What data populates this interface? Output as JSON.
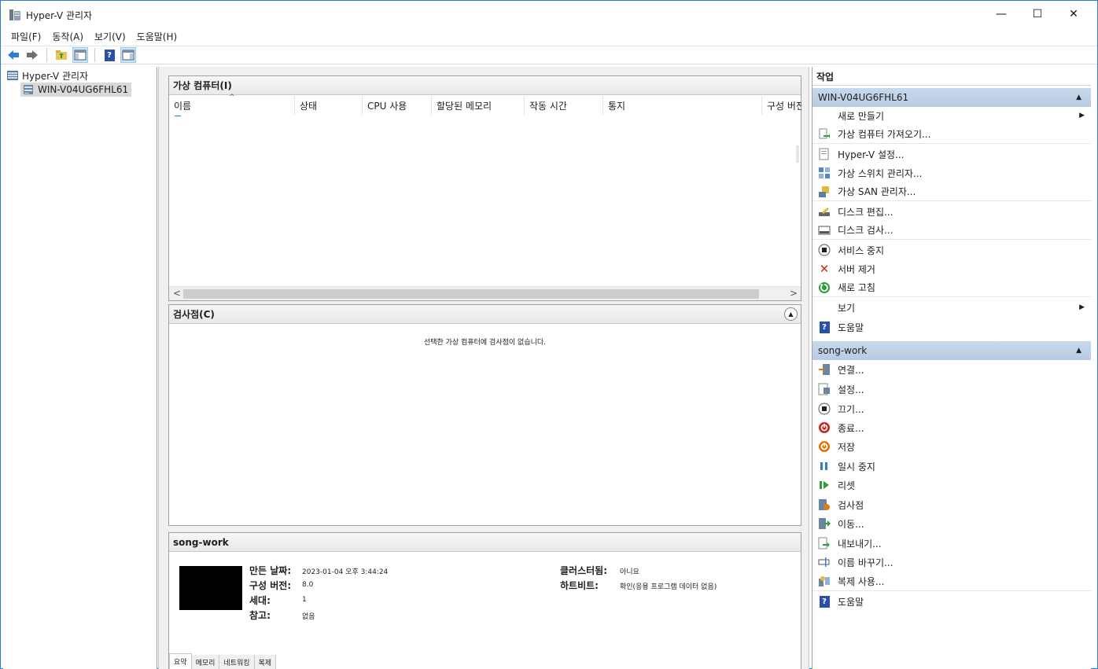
{
  "window": {
    "title": "Hyper-V 관리자",
    "controls": {
      "minimize": "—",
      "maximize": "☐",
      "close": "✕"
    }
  },
  "menu": [
    "파일(F)",
    "동작(A)",
    "보기(V)",
    "도움말(H)"
  ],
  "toolbar": {
    "icons": [
      "back-arrow-icon",
      "forward-arrow-icon",
      "up-folder-icon",
      "show-hide-tree-icon",
      "help-icon",
      "show-hide-action-pane-icon"
    ]
  },
  "tree": {
    "root": "Hyper-V 관리자",
    "child": "WIN-V04UG6FHL61"
  },
  "vm_panel": {
    "title": "가상 컴퓨터(I)",
    "columns": [
      "이름",
      "상태",
      "CPU 사용",
      "할당된 메모리",
      "작동 시간",
      "통지",
      "구성 버전"
    ],
    "sort_glyph": "^",
    "scroll_left": "<",
    "scroll_right": ">"
  },
  "checkpoint_panel": {
    "title": "검사점(C)",
    "empty_message": "선택한 가상 컴퓨터에 검사점이 없습니다.",
    "collapse_glyph": "▲"
  },
  "summary_panel": {
    "title": "song-work",
    "created_label": "만든 날짜:",
    "created_value": "2023-01-04 오후 3:44:24",
    "config_label": "구성 버전:",
    "config_value": "8.0",
    "generation_label": "세대:",
    "generation_value": "1",
    "notes_label": "참고:",
    "notes_value": "없음",
    "clustered_label": "클러스터됨:",
    "clustered_value": "아니요",
    "heartbeat_label": "하트비트:",
    "heartbeat_value": "확인(응용 프로그램 데이터 없음)",
    "tabs": [
      "요약",
      "메모리",
      "네트워킹",
      "복제"
    ]
  },
  "actions": {
    "title": "작업",
    "server_section": {
      "title": "WIN-V04UG6FHL61",
      "items": [
        {
          "label": "새로 만들기",
          "icon": "none",
          "submenu": "▶"
        },
        {
          "label": "가상 컴퓨터 가져오기...",
          "icon": "import-vm-icon"
        },
        {
          "label": "Hyper-V 설정...",
          "icon": "settings-page-icon"
        },
        {
          "label": "가상 스위치 관리자...",
          "icon": "virtual-switch-icon"
        },
        {
          "label": "가상 SAN 관리자...",
          "icon": "virtual-san-icon"
        },
        {
          "label": "디스크 편집...",
          "icon": "edit-disk-icon"
        },
        {
          "label": "디스크 검사...",
          "icon": "inspect-disk-icon"
        },
        {
          "label": "서비스 중지",
          "icon": "stop-service-icon"
        },
        {
          "label": "서버 제거",
          "icon": "remove-server-icon"
        },
        {
          "label": "새로 고침",
          "icon": "refresh-icon"
        },
        {
          "label": "보기",
          "icon": "none",
          "submenu": "▶"
        },
        {
          "label": "도움말",
          "icon": "help-icon"
        }
      ]
    },
    "vm_section": {
      "title": "song-work",
      "items": [
        {
          "label": "연결...",
          "icon": "connect-icon"
        },
        {
          "label": "설정...",
          "icon": "vm-settings-icon"
        },
        {
          "label": "끄기...",
          "icon": "turn-off-icon"
        },
        {
          "label": "종료...",
          "icon": "shutdown-icon"
        },
        {
          "label": "저장",
          "icon": "save-icon"
        },
        {
          "label": "일시 중지",
          "icon": "pause-icon"
        },
        {
          "label": "리셋",
          "icon": "reset-icon"
        },
        {
          "label": "검사점",
          "icon": "checkpoint-icon"
        },
        {
          "label": "이동...",
          "icon": "move-icon"
        },
        {
          "label": "내보내기...",
          "icon": "export-icon"
        },
        {
          "label": "이름 바꾸기...",
          "icon": "rename-icon"
        },
        {
          "label": "복제 사용...",
          "icon": "enable-replication-icon"
        },
        {
          "label": "도움말",
          "icon": "help-icon"
        }
      ]
    },
    "colors": {
      "section_bg": "#bfd2e8",
      "stop_red": "#c8281e",
      "refresh_green": "#2f9e3a",
      "save_orange": "#e07a10",
      "pause_blue": "#2f7fd0",
      "help_blue": "#2a4fa8"
    }
  }
}
